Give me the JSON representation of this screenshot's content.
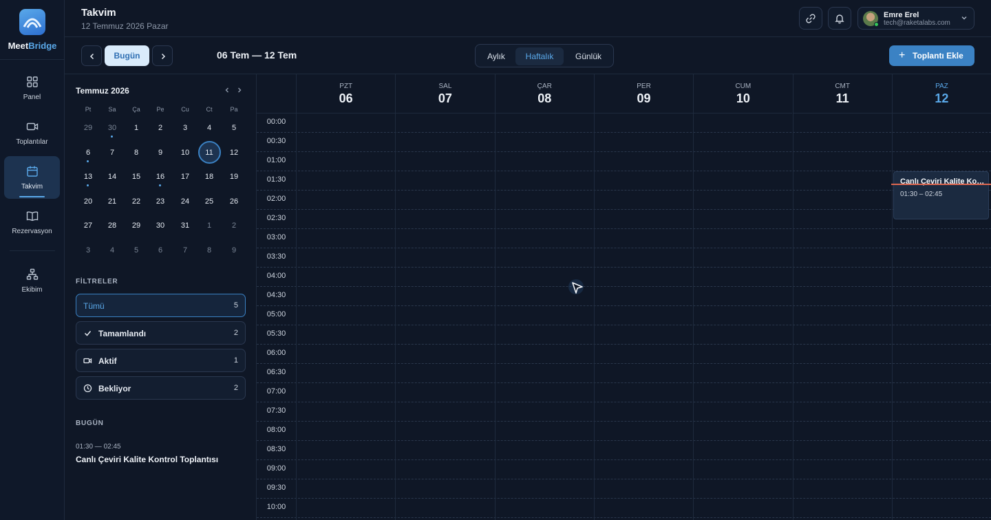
{
  "brand": {
    "part1": "Meet",
    "part2": "Bridge"
  },
  "nav": {
    "items": [
      {
        "label": "Panel",
        "icon": "grid-icon"
      },
      {
        "label": "Toplantılar",
        "icon": "video-icon"
      },
      {
        "label": "Takvim",
        "icon": "calendar-icon",
        "active": true
      },
      {
        "label": "Rezervasyon",
        "icon": "book-icon"
      },
      {
        "label": "Ekibim",
        "icon": "team-icon"
      }
    ]
  },
  "header": {
    "title": "Takvim",
    "subtitle": "12 Temmuz 2026 Pazar",
    "user": {
      "name": "Emre Erel",
      "email": "tech@raketalabs.com"
    }
  },
  "toolbar": {
    "today_label": "Bugün",
    "range_label": "06 Tem — 12 Tem",
    "views": [
      "Aylık",
      "Haftalık",
      "Günlük"
    ],
    "active_view": "Haftalık",
    "add_label": "Toplantı Ekle"
  },
  "mini_calendar": {
    "title": "Temmuz 2026",
    "weekdays": [
      "Pt",
      "Sa",
      "Ça",
      "Pe",
      "Cu",
      "Ct",
      "Pa"
    ],
    "weeks": [
      [
        "29",
        "30",
        "1",
        "2",
        "3",
        "4",
        "5"
      ],
      [
        "6",
        "7",
        "8",
        "9",
        "10",
        "11",
        "12"
      ],
      [
        "13",
        "14",
        "15",
        "16",
        "17",
        "18",
        "19"
      ],
      [
        "20",
        "21",
        "22",
        "23",
        "24",
        "25",
        "26"
      ],
      [
        "27",
        "28",
        "29",
        "30",
        "31",
        "1",
        "2"
      ],
      [
        "3",
        "4",
        "5",
        "6",
        "7",
        "8",
        "9"
      ]
    ],
    "selected": "11"
  },
  "filters": {
    "heading": "FİLTRELER",
    "items": [
      {
        "label": "Tümü",
        "count": "5",
        "icon": ""
      },
      {
        "label": "Tamamlandı",
        "count": "2",
        "icon": "check-icon"
      },
      {
        "label": "Aktif",
        "count": "1",
        "icon": "video-icon"
      },
      {
        "label": "Bekliyor",
        "count": "2",
        "icon": "clock-icon"
      }
    ]
  },
  "today": {
    "heading": "BUGÜN",
    "time": "01:30 — 02:45",
    "name": "Canlı Çeviri Kalite Kontrol Toplantısı"
  },
  "week": {
    "days": [
      {
        "name": "PZT",
        "date": "06"
      },
      {
        "name": "SAL",
        "date": "07"
      },
      {
        "name": "ÇAR",
        "date": "08"
      },
      {
        "name": "PER",
        "date": "09"
      },
      {
        "name": "CUM",
        "date": "10"
      },
      {
        "name": "CMT",
        "date": "11"
      },
      {
        "name": "PAZ",
        "date": "12",
        "today": true
      }
    ],
    "times": [
      "00:00",
      "00:30",
      "01:00",
      "01:30",
      "02:00",
      "02:30",
      "03:00",
      "03:30",
      "04:00",
      "04:30",
      "05:00",
      "05:30",
      "06:00",
      "06:30",
      "07:00",
      "07:30",
      "08:00",
      "08:30",
      "09:00",
      "09:30",
      "10:00"
    ]
  },
  "event": {
    "title": "Canlı Çeviri Kalite Kontrol Toplantısı",
    "time": "01:30 – 02:45"
  },
  "colors": {
    "accent": "#5aa9ea",
    "primary_button": "#3b82c4",
    "now_line": "#e0674f",
    "background": "#0f1726"
  }
}
